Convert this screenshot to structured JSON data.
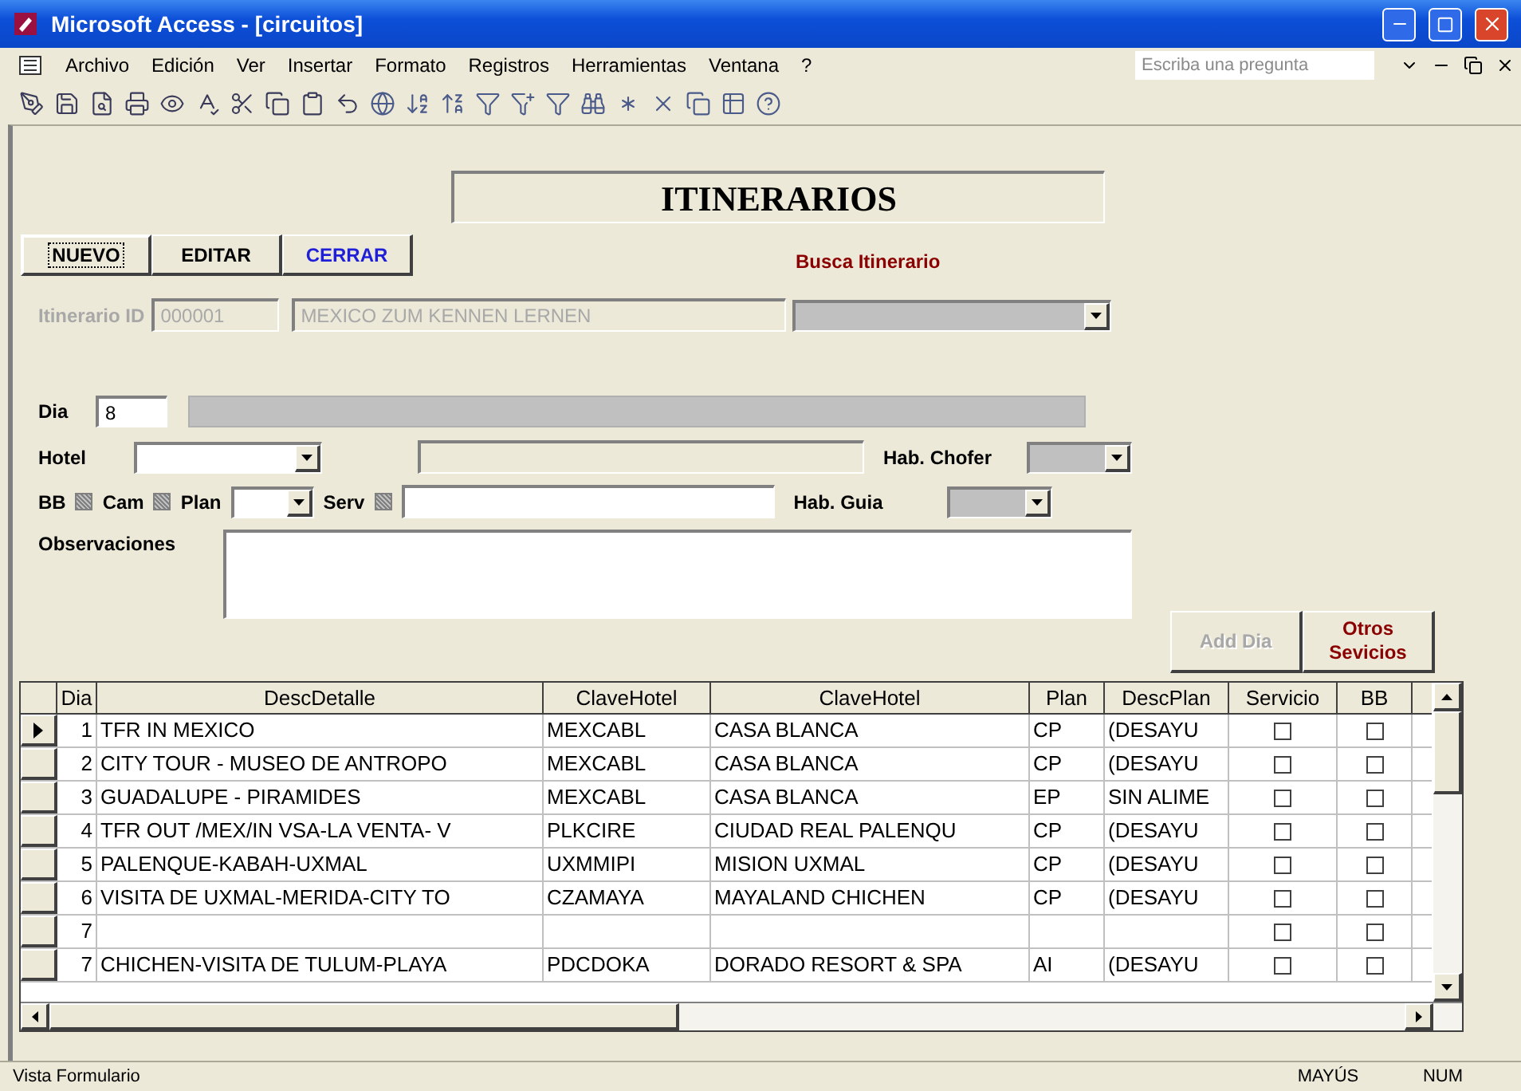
{
  "window": {
    "title": "Microsoft Access - [circuitos]"
  },
  "menu": [
    "Archivo",
    "Edición",
    "Ver",
    "Insertar",
    "Formato",
    "Registros",
    "Herramientas",
    "Ventana",
    "?"
  ],
  "help_search": {
    "placeholder": "Escriba una pregunta"
  },
  "form": {
    "title": "ITINERARIOS",
    "buttons": [
      {
        "label": "NUEVO",
        "focused": true,
        "color": "#000000"
      },
      {
        "label": "EDITAR",
        "focused": false,
        "color": "#000000"
      },
      {
        "label": "CERRAR",
        "focused": false,
        "color": "#1f1fd8"
      }
    ],
    "search_label": "Busca Itinerario",
    "itinerary": {
      "label": "Itinerario ID",
      "id": "000001",
      "name": "MEXICO ZUM KENNEN LERNEN",
      "disabled": true
    },
    "dia": {
      "label": "Dia",
      "value": "8"
    },
    "hotel": {
      "label": "Hotel"
    },
    "hab_chofer": {
      "label": "Hab. Chofer"
    },
    "checks": [
      {
        "label": "BB",
        "indeterminate": true
      },
      {
        "label": "Cam",
        "indeterminate": true
      }
    ],
    "plan": {
      "label": "Plan"
    },
    "serv": {
      "label": "Serv",
      "indeterminate": true
    },
    "hab_guia": {
      "label": "Hab. Guia"
    },
    "observaciones": {
      "label": "Observaciones"
    },
    "actions": [
      {
        "label": "Add Dia",
        "disabled": true,
        "color": "#a8a8a8"
      },
      {
        "label": "Otros Sevicios",
        "disabled": false,
        "color": "#8b0000"
      }
    ]
  },
  "table": {
    "columns": [
      "Dia",
      "DescDetalle",
      "ClaveHotel",
      "ClaveHotel",
      "Plan",
      "DescPlan",
      "Servicio",
      "BB"
    ],
    "rows": [
      {
        "selected": true,
        "cells": [
          "1",
          "TFR IN MEXICO",
          "MEXCABL",
          "CASA BLANCA",
          "CP",
          "(DESAYU"
        ],
        "servicio": false,
        "bb": false
      },
      {
        "selected": false,
        "cells": [
          "2",
          "CITY TOUR - MUSEO DE ANTROPO",
          "MEXCABL",
          "CASA BLANCA",
          "CP",
          "(DESAYU"
        ],
        "servicio": false,
        "bb": false
      },
      {
        "selected": false,
        "cells": [
          "3",
          "GUADALUPE - PIRAMIDES",
          "MEXCABL",
          "CASA BLANCA",
          "EP",
          "SIN ALIME"
        ],
        "servicio": false,
        "bb": false
      },
      {
        "selected": false,
        "cells": [
          "4",
          "TFR OUT /MEX/IN VSA-LA VENTA- V",
          "PLKCIRE",
          "CIUDAD REAL  PALENQU",
          "CP",
          "(DESAYU"
        ],
        "servicio": false,
        "bb": false
      },
      {
        "selected": false,
        "cells": [
          "5",
          "PALENQUE-KABAH-UXMAL",
          "UXMMIPI",
          "MISION UXMAL",
          "CP",
          "(DESAYU"
        ],
        "servicio": false,
        "bb": false
      },
      {
        "selected": false,
        "cells": [
          "6",
          "VISITA DE UXMAL-MERIDA-CITY TO",
          "CZAMAYA",
          "MAYALAND CHICHEN",
          "CP",
          "(DESAYU"
        ],
        "servicio": false,
        "bb": false
      },
      {
        "selected": false,
        "cells": [
          "7",
          "",
          "",
          "",
          "",
          ""
        ],
        "servicio": false,
        "bb": false
      },
      {
        "selected": false,
        "cells": [
          "7",
          "CHICHEN-VISITA DE TULUM-PLAYA",
          "PDCDOKA",
          "DORADO RESORT & SPA",
          "AI",
          "(DESAYU"
        ],
        "servicio": false,
        "bb": false
      }
    ]
  },
  "status_bar": {
    "text": "Vista Formulario",
    "indicators": [
      "MAYÚS",
      "NUM"
    ]
  }
}
